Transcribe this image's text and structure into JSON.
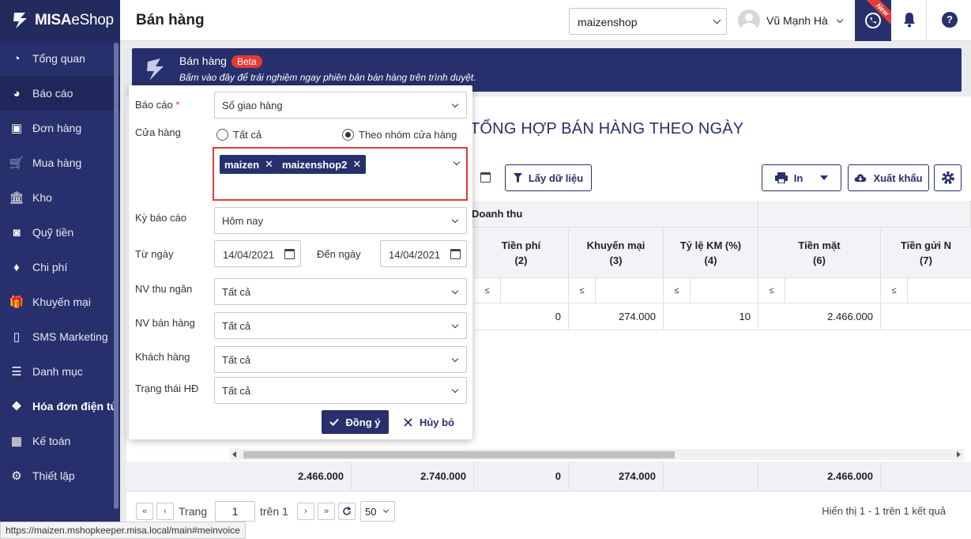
{
  "sidebar": {
    "logo": {
      "brand": "MISA",
      "product": "eShop"
    },
    "items": [
      {
        "label": "Tổng quan",
        "icon": "dashboard-icon"
      },
      {
        "label": "Báo cáo",
        "icon": "pie-chart-icon"
      },
      {
        "label": "Đơn hàng",
        "icon": "orders-icon"
      },
      {
        "label": "Mua hàng",
        "icon": "cart-icon"
      },
      {
        "label": "Kho",
        "icon": "warehouse-icon"
      },
      {
        "label": "Quỹ tiền",
        "icon": "safe-icon"
      },
      {
        "label": "Chi phí",
        "icon": "money-icon"
      },
      {
        "label": "Khuyến mại",
        "icon": "gift-icon"
      },
      {
        "label": "SMS Marketing",
        "icon": "phone-icon"
      },
      {
        "label": "Danh mục",
        "icon": "list-icon"
      },
      {
        "label": "Hóa đơn điện tử",
        "icon": "einvoice-icon"
      },
      {
        "label": "Kế toán",
        "icon": "calculator-icon"
      },
      {
        "label": "Thiết lập",
        "icon": "gear-icon"
      }
    ]
  },
  "header": {
    "title": "Bán hàng",
    "shop": "maizenshop",
    "user": "Vũ Mạnh Hà",
    "new_badge": "New",
    "help": "?"
  },
  "banner": {
    "title": "Bán hàng",
    "badge": "Beta",
    "subtitle": "Bấm vào đây để trải nghiệm ngay phiên bản bán hàng trên trình duyệt."
  },
  "report": {
    "title": "TỔNG HỢP BÁN HÀNG THEO NGÀY",
    "fetch_label": "Lấy dữ liệu",
    "print_label": "In",
    "export_label": "Xuất khẩu",
    "group_header": "Doanh thu",
    "columns": [
      {
        "name": "Tiền phí",
        "num": "(2)"
      },
      {
        "name": "Khuyến mại",
        "num": "(3)"
      },
      {
        "name": "Tỷ lệ KM (%)",
        "num": "(4)"
      },
      {
        "name": "Tiền mặt",
        "num": "(6)"
      },
      {
        "name": "Tiền gửi N",
        "num": "(7)"
      }
    ],
    "filter_op": "≤",
    "row": [
      "0",
      "274.000",
      "10",
      "2.466.000"
    ],
    "totals": [
      "2.466.000",
      "2.740.000",
      "0",
      "274.000",
      "2.466.000"
    ]
  },
  "pager": {
    "page_label": "Trang",
    "page": "1",
    "of_label": "trên 1",
    "page_size": "50",
    "result": "Hiển thị 1 - 1 trên 1 kết quả"
  },
  "popup": {
    "report_label": "Báo cáo",
    "required_mark": "*",
    "report_value": "Sổ giao hàng",
    "store_label": "Cửa hàng",
    "radio_all": "Tất cả",
    "radio_group": "Theo nhóm cửa hàng",
    "tags": [
      "maizen",
      "maizenshop2"
    ],
    "period_label": "Kỳ báo cáo",
    "period_value": "Hôm nay",
    "from_label": "Từ ngày",
    "from_value": "14/04/2021",
    "to_label": "Đến ngày",
    "to_value": "14/04/2021",
    "cashier_label": "NV thu ngân",
    "cashier_value": "Tất cả",
    "seller_label": "NV bán hàng",
    "seller_value": "Tất cả",
    "customer_label": "Khách hàng",
    "customer_value": "Tất cả",
    "invoice_status_label": "Trạng thái HĐ",
    "invoice_status_value": "Tất cả",
    "ok_label": "Đồng ý",
    "cancel_label": "Hủy bỏ"
  },
  "status_url": "https://maizen.mshopkeeper.misa.local/main#meinvoice",
  "colors": {
    "primary": "#27306c",
    "danger": "#e53935"
  }
}
